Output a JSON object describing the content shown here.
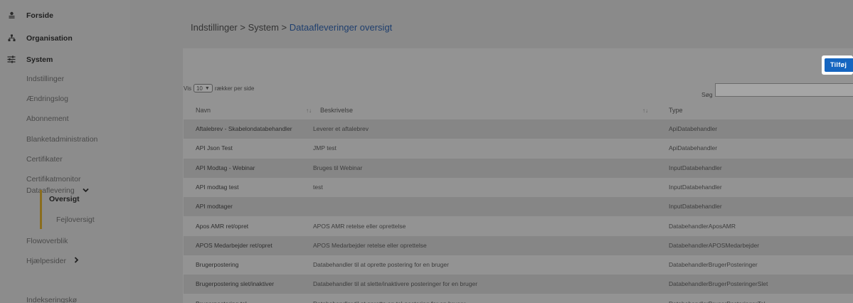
{
  "sidebar": {
    "top_items": [
      {
        "label": "Forside",
        "icon": "person-icon"
      },
      {
        "label": "Organisation",
        "icon": "org-chart-icon"
      },
      {
        "label": "System",
        "icon": "sliders-icon"
      }
    ],
    "system_items": [
      "Indstillinger",
      "Ændringslog",
      "Abonnement",
      "Blanketadministration",
      "Certifikater",
      "Certifikatmonitor"
    ],
    "dataaflevering": {
      "label": "Dataaflevering",
      "chevron": "chevron-down-icon"
    },
    "sub_items": {
      "active": "Oversigt",
      "other": "Fejloversigt"
    },
    "bottom_items": [
      {
        "label": "Flowoverblik"
      },
      {
        "label": "Hjælpesider"
      },
      {
        "label": "Indekseringskø"
      }
    ]
  },
  "breadcrumb": {
    "part1": "Indstillinger",
    "sep1": " > ",
    "part2": "System",
    "sep2": " > ",
    "current": "Dataafleveringer oversigt"
  },
  "toolbar": {
    "add_label": "Tilføj"
  },
  "paging": {
    "prefix": "Vis",
    "value": "10",
    "suffix": "rækker per side"
  },
  "search": {
    "label": "Søg",
    "value": ""
  },
  "table": {
    "columns": [
      "Navn",
      "Beskrivelse",
      "Type"
    ],
    "rows": [
      [
        "Aftalebrev - Skabelondatabehandler",
        "Leverer et aftalebrev",
        "ApiDatabehandler"
      ],
      [
        "API Json Test",
        "JMP test",
        "ApiDatabehandler"
      ],
      [
        "API Modtag - Webinar",
        "Bruges til Webinar",
        "InputDatabehandler"
      ],
      [
        "API modtag test",
        "test",
        "InputDatabehandler"
      ],
      [
        "API modtager",
        "",
        "InputDatabehandler"
      ],
      [
        "Apos AMR ret/opret",
        "APOS AMR retelse eller oprettelse",
        "DatabehandlerAposAMR"
      ],
      [
        "APOS Medarbejder ret/opret",
        "APOS Medarbejder retelse eller oprettelse",
        "DatabehandlerAPOSMedarbejder"
      ],
      [
        "Brugerpostering",
        "Databehandler til at oprette postering for en bruger",
        "DatabehandlerBrugerPosteringer"
      ],
      [
        "Brugerpostering slet/inaktiver",
        "Databehandler til at slette/inaktivere posteringer for en bruger",
        "DatabehandlerBrugerPosteringerSlet"
      ],
      [
        "Brugerpostering tal",
        "Databehandler til at oprette en tal-postering for en bruger",
        "DatabehandlerBrugerPosteringerTal"
      ]
    ]
  },
  "colors": {
    "accent": "#1565c0",
    "active_marker": "#8a6d1e",
    "link": "#1f3f6e"
  }
}
